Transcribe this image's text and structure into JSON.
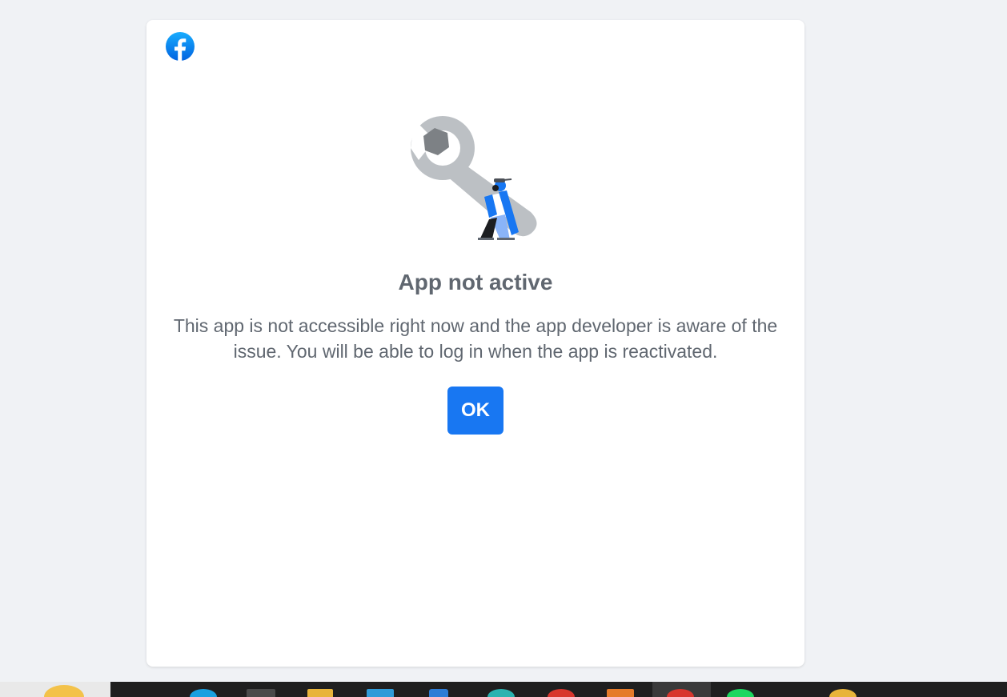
{
  "dialog": {
    "title": "App not active",
    "message": "This app is not accessible right now and the app developer is aware of the issue. You will be able to log in when the app is reactivated.",
    "ok_label": "OK",
    "logo_icon": "facebook-logo-icon",
    "illustration_icon": "wrench-worker-illustration"
  },
  "colors": {
    "page_background": "#f0f2f5",
    "dialog_background": "#ffffff",
    "text": "#606770",
    "accent": "#1877f2"
  },
  "taskbar": {
    "icons": [
      "app-icon",
      "app-icon",
      "app-icon",
      "folder-icon",
      "app-icon",
      "app-icon",
      "app-icon",
      "app-icon",
      "app-icon",
      "app-icon",
      "app-icon",
      "app-icon"
    ]
  }
}
